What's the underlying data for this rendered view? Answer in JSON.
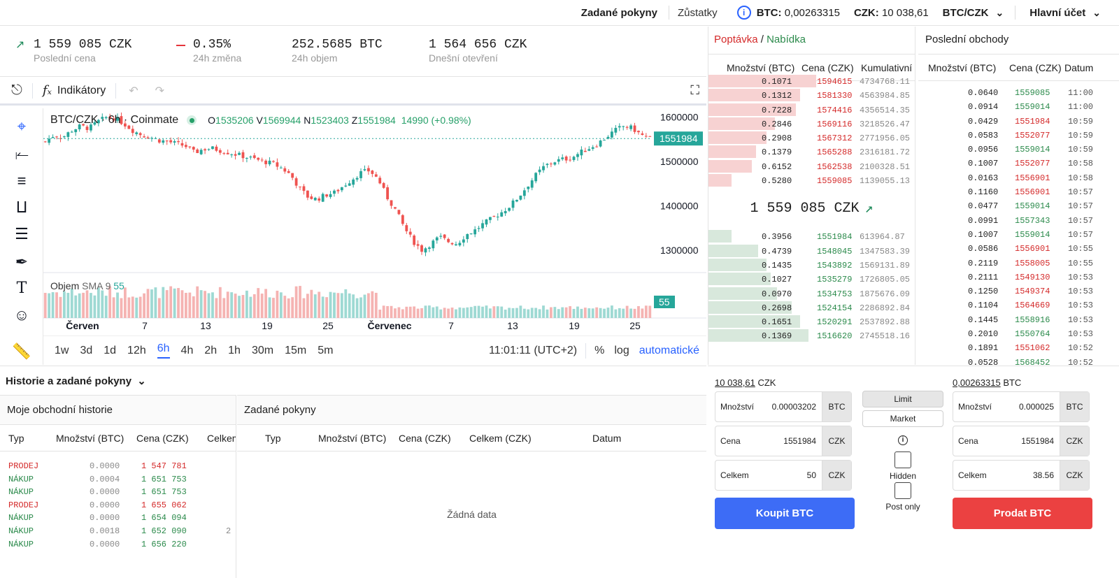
{
  "topbar": {
    "orders": "Zadané pokyny",
    "balances": "Zůstatky",
    "info_icon": "i",
    "btc_label": "BTC:",
    "btc_value": "0,00263315",
    "czk_label": "CZK:",
    "czk_value": "10 038,61",
    "pair": "BTC/CZK",
    "account": "Hlavní účet"
  },
  "stats": [
    {
      "value": "1 559 085 CZK",
      "label": "Poslední cena"
    },
    {
      "value": "0.35%",
      "label": "24h změna"
    },
    {
      "value": "252.5685 BTC",
      "label": "24h objem"
    },
    {
      "value": "1 564 656 CZK",
      "label": "Dnešní otevření"
    }
  ],
  "toolbar": {
    "indicators": "Indikátory"
  },
  "chart": {
    "title": "BTC/CZK · 6h · Coinmate",
    "o_label": "O",
    "o": "1535206",
    "v_label": "V",
    "v": "1569944",
    "n_label": "N",
    "n": "1523403",
    "z_label": "Z",
    "z": "1551984",
    "change": "14990 (+0.98%)",
    "y_ticks": [
      "1600000",
      "1500000",
      "1400000",
      "1300000"
    ],
    "last_price_tag": "1551984",
    "volume_label": "Objem",
    "sma_label": "SMA 9",
    "sma_value": "55",
    "volume_tag": "55",
    "x_ticks": [
      "Červen",
      "7",
      "13",
      "19",
      "25",
      "Červenec",
      "7",
      "13",
      "19",
      "25"
    ],
    "timeframes": [
      "1w",
      "3d",
      "1d",
      "12h",
      "6h",
      "4h",
      "2h",
      "1h",
      "30m",
      "15m",
      "5m"
    ],
    "active_timeframe": "6h",
    "clock": "11:01:11 (UTC+2)",
    "pct": "%",
    "log": "log",
    "auto": "automatické",
    "colors": {
      "up": "#26a69a",
      "down": "#ef5350"
    }
  },
  "chart_data": {
    "type": "candlestick",
    "title": "BTC/CZK · 6h · Coinmate",
    "x_ticks": [
      "Červen",
      "7",
      "13",
      "19",
      "25",
      "Červenec",
      "7",
      "13",
      "19",
      "25"
    ],
    "ylim": [
      1250000,
      1620000
    ],
    "y_ticks": [
      1600000,
      1500000,
      1400000,
      1300000
    ],
    "last": 1551984,
    "closes": [
      1545000,
      1560000,
      1555000,
      1570000,
      1580000,
      1575000,
      1590000,
      1600000,
      1598000,
      1585000,
      1570000,
      1560000,
      1555000,
      1548000,
      1545000,
      1540000,
      1535000,
      1520000,
      1528000,
      1530000,
      1525000,
      1520000,
      1515000,
      1510000,
      1505000,
      1500000,
      1495000,
      1485000,
      1470000,
      1440000,
      1420000,
      1415000,
      1425000,
      1430000,
      1445000,
      1460000,
      1475000,
      1480000,
      1460000,
      1420000,
      1390000,
      1350000,
      1320000,
      1300000,
      1315000,
      1330000,
      1320000,
      1315000,
      1335000,
      1345000,
      1360000,
      1372000,
      1385000,
      1400000,
      1420000,
      1445000,
      1470000,
      1490000,
      1500000,
      1505000,
      1508000,
      1520000,
      1530000,
      1540000,
      1555000,
      1570000,
      1580000,
      1575000,
      1560000,
      1552000
    ]
  },
  "orderbook": {
    "title_bid": "Poptávka",
    "slash": "/",
    "title_ask": "Nabídka",
    "cols": [
      "Množství (BTC)",
      "Cena (CZK)",
      "Kumulativní"
    ],
    "asks": [
      {
        "q": "0.1071",
        "p": "1594615",
        "c": "4734768.11",
        "d": 0.52
      },
      {
        "q": "0.1312",
        "p": "1581330",
        "c": "4563984.85",
        "d": 0.44
      },
      {
        "q": "0.7228",
        "p": "1574416",
        "c": "4356514.35",
        "d": 0.42
      },
      {
        "q": "0.2846",
        "p": "1569116",
        "c": "3218526.47",
        "d": 0.32
      },
      {
        "q": "0.2908",
        "p": "1567312",
        "c": "2771956.05",
        "d": 0.28
      },
      {
        "q": "0.1379",
        "p": "1565288",
        "c": "2316181.72",
        "d": 0.23
      },
      {
        "q": "0.6152",
        "p": "1562538",
        "c": "2100328.51",
        "d": 0.21
      },
      {
        "q": "0.5280",
        "p": "1559085",
        "c": "1139055.13",
        "d": 0.11
      }
    ],
    "mid": "1 559 085 CZK",
    "bids": [
      {
        "q": "0.3956",
        "p": "1551984",
        "c": "613964.87",
        "d": 0.11
      },
      {
        "q": "0.4739",
        "p": "1548045",
        "c": "1347583.39",
        "d": 0.24
      },
      {
        "q": "0.1435",
        "p": "1543892",
        "c": "1569131.89",
        "d": 0.28
      },
      {
        "q": "0.1027",
        "p": "1535279",
        "c": "1726805.05",
        "d": 0.3
      },
      {
        "q": "0.0970",
        "p": "1534753",
        "c": "1875676.09",
        "d": 0.33
      },
      {
        "q": "0.2698",
        "p": "1524154",
        "c": "2286892.84",
        "d": 0.4
      },
      {
        "q": "0.1651",
        "p": "1520291",
        "c": "2537892.88",
        "d": 0.44
      },
      {
        "q": "0.1369",
        "p": "1516620",
        "c": "2745518.16",
        "d": 0.48
      }
    ]
  },
  "trades": {
    "title": "Poslední obchody",
    "cols": [
      "Množství (BTC)",
      "Cena (CZK)",
      "Datum"
    ],
    "rows": [
      {
        "q": "0.0640",
        "p": "1559085",
        "t": "11:00",
        "s": "buy"
      },
      {
        "q": "0.0914",
        "p": "1559014",
        "t": "11:00",
        "s": "buy"
      },
      {
        "q": "0.0429",
        "p": "1551984",
        "t": "10:59",
        "s": "sell"
      },
      {
        "q": "0.0583",
        "p": "1552077",
        "t": "10:59",
        "s": "sell"
      },
      {
        "q": "0.0956",
        "p": "1559014",
        "t": "10:59",
        "s": "buy"
      },
      {
        "q": "0.1007",
        "p": "1552077",
        "t": "10:58",
        "s": "sell"
      },
      {
        "q": "0.0163",
        "p": "1556901",
        "t": "10:58",
        "s": "sell"
      },
      {
        "q": "0.1160",
        "p": "1556901",
        "t": "10:57",
        "s": "sell"
      },
      {
        "q": "0.0477",
        "p": "1559014",
        "t": "10:57",
        "s": "buy"
      },
      {
        "q": "0.0991",
        "p": "1557343",
        "t": "10:57",
        "s": "buy"
      },
      {
        "q": "0.1007",
        "p": "1559014",
        "t": "10:57",
        "s": "buy"
      },
      {
        "q": "0.0586",
        "p": "1556901",
        "t": "10:55",
        "s": "sell"
      },
      {
        "q": "0.2119",
        "p": "1558005",
        "t": "10:55",
        "s": "sell"
      },
      {
        "q": "0.2111",
        "p": "1549130",
        "t": "10:53",
        "s": "sell"
      },
      {
        "q": "0.1250",
        "p": "1549374",
        "t": "10:53",
        "s": "sell"
      },
      {
        "q": "0.1104",
        "p": "1564669",
        "t": "10:53",
        "s": "sell"
      },
      {
        "q": "0.1445",
        "p": "1558916",
        "t": "10:53",
        "s": "buy"
      },
      {
        "q": "0.2010",
        "p": "1550764",
        "t": "10:53",
        "s": "buy"
      },
      {
        "q": "0.1891",
        "p": "1551062",
        "t": "10:52",
        "s": "sell"
      },
      {
        "q": "0.0528",
        "p": "1568452",
        "t": "10:52",
        "s": "buy"
      }
    ]
  },
  "history": {
    "header": "Historie a zadané pokyny",
    "my_title": "Moje obchodní historie",
    "my_cols": [
      "Typ",
      "Množství (BTC)",
      "Cena (CZK)",
      "Celkem"
    ],
    "rows": [
      {
        "type": "PRODEJ",
        "q": "0.0000",
        "p": "1 547 781",
        "s": "sell"
      },
      {
        "type": "NÁKUP",
        "q": "0.0004",
        "p": "1 651 753",
        "s": "buy"
      },
      {
        "type": "NÁKUP",
        "q": "0.0000",
        "p": "1 651 753",
        "s": "buy"
      },
      {
        "type": "PRODEJ",
        "q": "0.0000",
        "p": "1 655 062",
        "s": "sell"
      },
      {
        "type": "NÁKUP",
        "q": "0.0000",
        "p": "1 654 094",
        "s": "buy"
      },
      {
        "type": "NÁKUP",
        "q": "0.0018",
        "p": "1 652 090",
        "s": "buy",
        "t": "2"
      },
      {
        "type": "NÁKUP",
        "q": "0.0000",
        "p": "1 656 220",
        "s": "buy"
      }
    ],
    "orders_title": "Zadané pokyny",
    "orders_cols": [
      "Typ",
      "Množství (BTC)",
      "Cena (CZK)",
      "Celkem (CZK)",
      "Datum"
    ],
    "empty": "Žádná data"
  },
  "form": {
    "czk_bal": "10 038,61",
    "czk_unit": "CZK",
    "btc_bal": "0,00263315",
    "btc_unit": "BTC",
    "buy": {
      "qty_label": "Množství",
      "qty": "0.00003202",
      "qty_unit": "BTC",
      "price_label": "Cena",
      "price": "1551984",
      "price_unit": "CZK",
      "total_label": "Celkem",
      "total": "50",
      "total_unit": "CZK",
      "button": "Koupit BTC"
    },
    "sell": {
      "qty_label": "Množství",
      "qty": "0.000025",
      "qty_unit": "BTC",
      "price_label": "Cena",
      "price": "1551984",
      "price_unit": "CZK",
      "total_label": "Celkem",
      "total": "38.56",
      "total_unit": "CZK",
      "button": "Prodat BTC"
    },
    "limit": "Limit",
    "market": "Market",
    "hidden": "Hidden",
    "post_only": "Post only",
    "colors": {
      "buy": "#3d6cf6",
      "sell": "#eb4141"
    }
  }
}
